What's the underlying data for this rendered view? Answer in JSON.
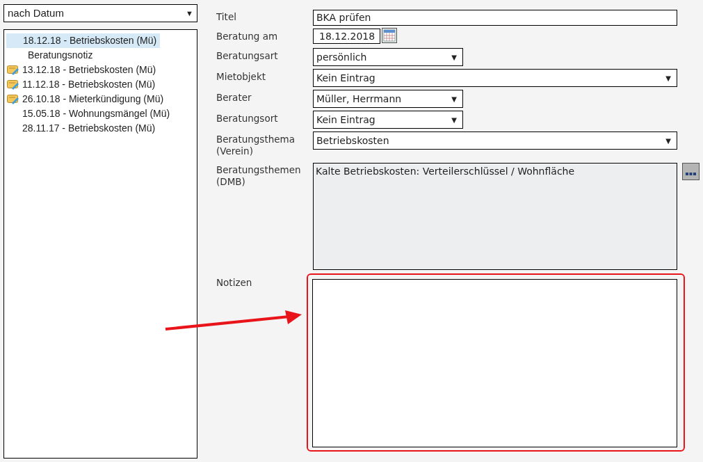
{
  "sort_select": {
    "value": "nach Datum",
    "arrow": "▼"
  },
  "tree": [
    {
      "label": "18.12.18 - Betriebskosten (Mü)",
      "selected": true,
      "note_icon": false,
      "children": [
        {
          "label": "Beratungsnotiz",
          "selected": false
        }
      ]
    },
    {
      "label": "13.12.18 - Betriebskosten (Mü)",
      "selected": false,
      "note_icon": true
    },
    {
      "label": "11.12.18 - Betriebskosten (Mü)",
      "selected": false,
      "note_icon": true
    },
    {
      "label": "26.10.18 - Mieterkündigung (Mü)",
      "selected": false,
      "note_icon": true
    },
    {
      "label": "15.05.18 - Wohnungsmängel (Mü)",
      "selected": false,
      "note_icon": false
    },
    {
      "label": "28.11.17 - Betriebskosten (Mü)",
      "selected": false,
      "note_icon": false
    }
  ],
  "form": [
    {
      "label": "Titel",
      "kind": "text",
      "value": "BKA prüfen"
    },
    {
      "label": "Beratung am",
      "kind": "date",
      "value": "18.12.2018"
    },
    {
      "label": "Beratungsart",
      "kind": "select_short",
      "value": "persönlich",
      "arrow": "▼"
    },
    {
      "label": "Mietobjekt",
      "kind": "select_wide",
      "value": "Kein Eintrag",
      "arrow": "▼"
    },
    {
      "label": "Berater",
      "kind": "select_short",
      "value": "Müller, Herrmann",
      "arrow": "▼"
    },
    {
      "label": "Beratungsort",
      "kind": "select_short",
      "value": "Kein Eintrag",
      "arrow": "▼"
    },
    {
      "label": "Beratungsthema (Verein)",
      "kind": "select_wide",
      "value": "Betriebskosten",
      "arrow": "▼"
    },
    {
      "label": "Beratungsthemen (DMB)",
      "kind": "readonly_area",
      "value": "Kalte Betriebskosten: Verteilerschlüssel / Wohnfläche"
    },
    {
      "label": "Notizen",
      "kind": "notes",
      "highlighted": true
    }
  ]
}
